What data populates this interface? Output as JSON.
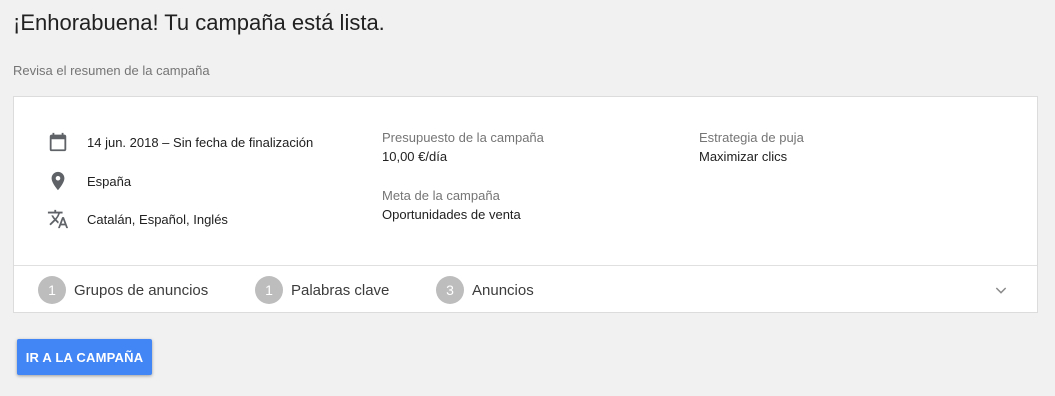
{
  "header": {
    "title": "¡Enhorabuena! Tu campaña está lista.",
    "subtitle": "Revisa el resumen de la campaña"
  },
  "summary": {
    "dates": {
      "icon": "calendar-icon",
      "text": "14 jun. 2018 – Sin fecha de finalización"
    },
    "location": {
      "icon": "location-pin-icon",
      "text": "España"
    },
    "languages": {
      "icon": "translate-icon",
      "text": "Catalán, Español, Inglés"
    },
    "budget": {
      "label": "Presupuesto de la campaña",
      "value": "10,00 €/día"
    },
    "goal": {
      "label": "Meta de la campaña",
      "value": "Oportunidades de venta"
    },
    "bidding": {
      "label": "Estrategia de puja",
      "value": "Maximizar clics"
    }
  },
  "counts": [
    {
      "count": "1",
      "label": "Grupos de anuncios"
    },
    {
      "count": "1",
      "label": "Palabras clave"
    },
    {
      "count": "3",
      "label": "Anuncios"
    }
  ],
  "expand_icon": "chevron-down-icon",
  "cta": {
    "label": "IR A LA CAMPAÑA",
    "color": "#4285f4"
  },
  "colors": {
    "background": "#f1f1f1",
    "card": "#ffffff",
    "muted_text": "#757575",
    "count_badge": "#bdbdbd"
  }
}
